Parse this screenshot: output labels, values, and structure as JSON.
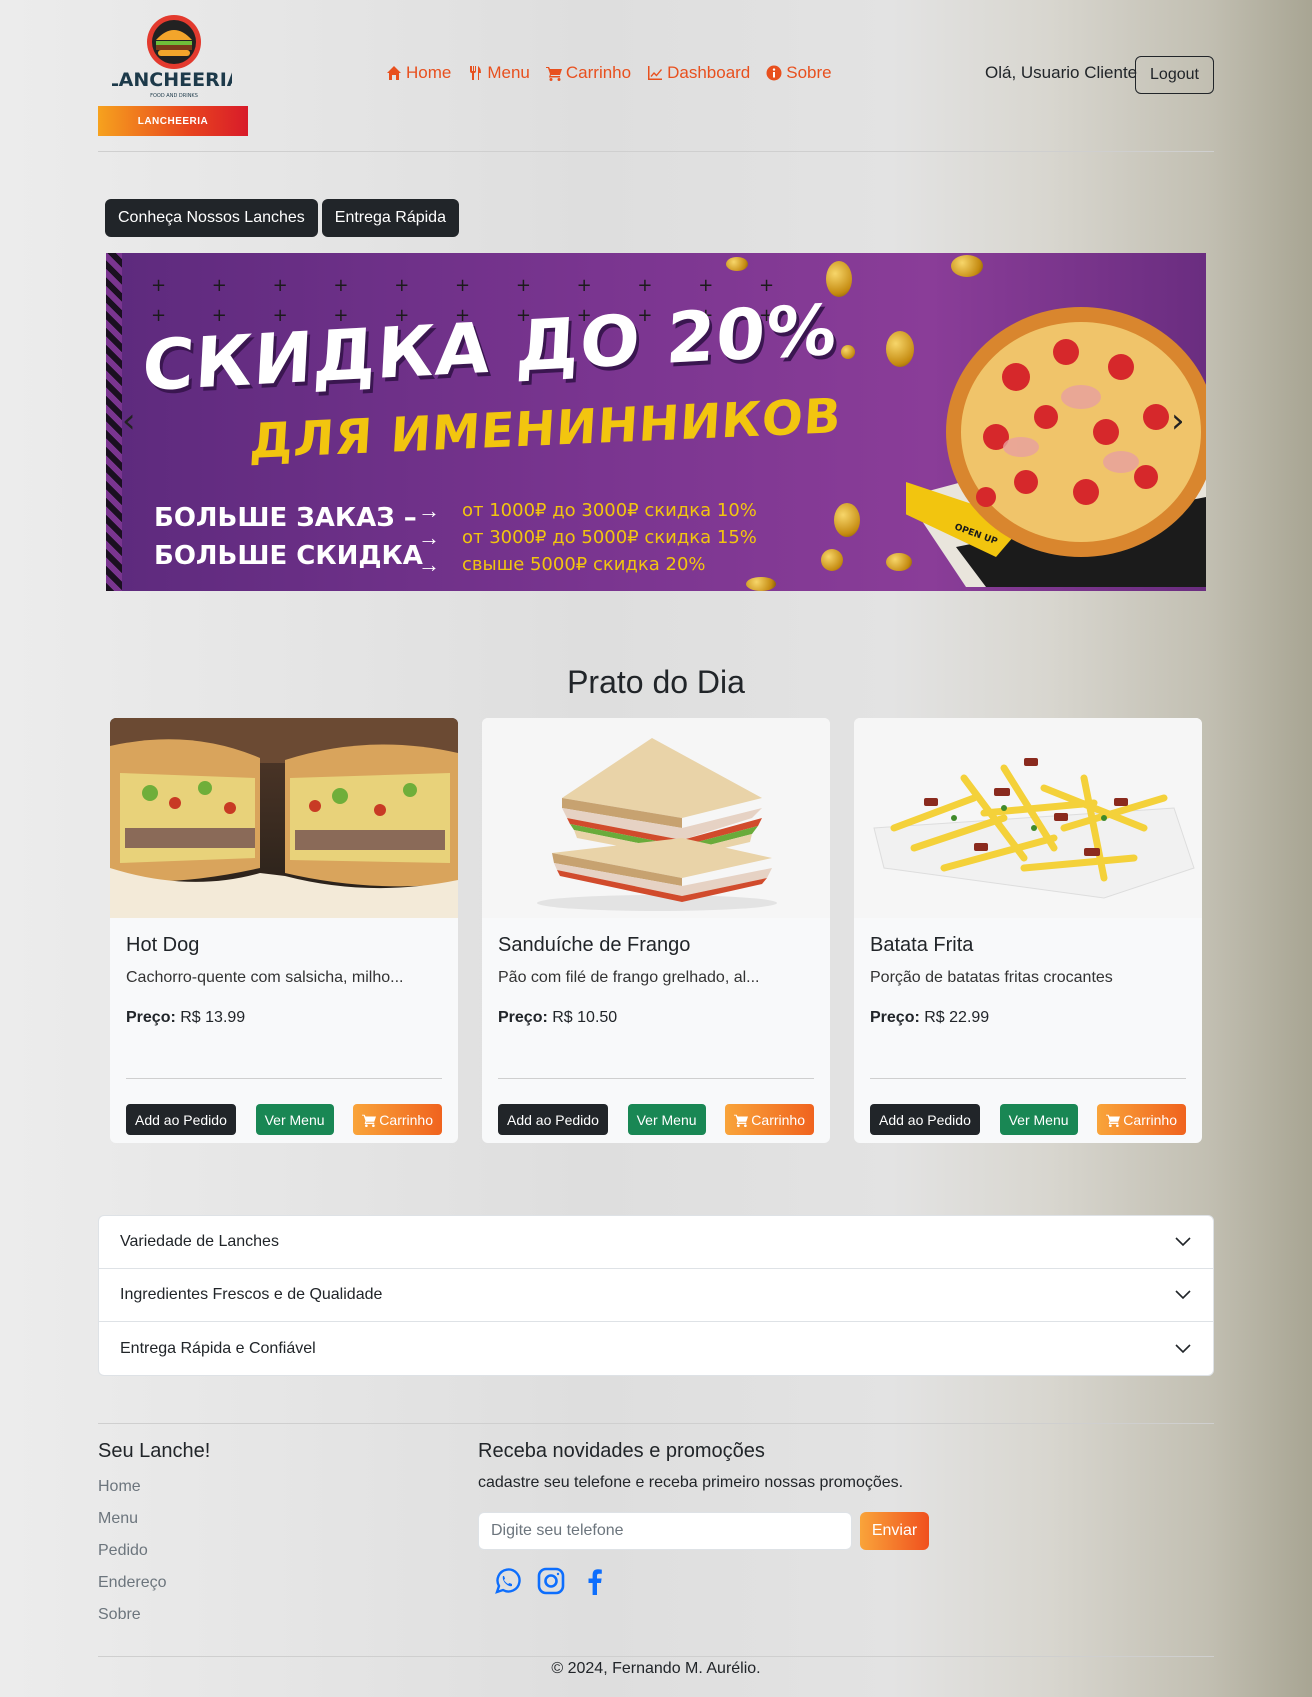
{
  "brand": {
    "name": "LANCHEERIA",
    "tagline": "FOOD AND DRINKS"
  },
  "nav": [
    {
      "label": "Home",
      "icon": "home-icon"
    },
    {
      "label": "Menu",
      "icon": "utensils-icon"
    },
    {
      "label": "Carrinho",
      "icon": "cart-icon"
    },
    {
      "label": "Dashboard",
      "icon": "chart-line-icon"
    },
    {
      "label": "Sobre",
      "icon": "info-circle-icon"
    }
  ],
  "user": {
    "greeting": "Olá, Usuario Cliente",
    "logout_label": "Logout"
  },
  "hero": {
    "btn_primary": "Conheça Nossos Lanches",
    "btn_secondary": "Entrega Rápida"
  },
  "banner": {
    "title": "СКИДКА ДО 20%",
    "subtitle": "ДЛЯ ИМЕНИННИКОВ",
    "left_line1": "БОЛЬШЕ ЗАКАЗ –",
    "left_line2": "БОЛЬШЕ СКИДКА",
    "tier1": "от 1000₽ до 3000₽ скидка 10%",
    "tier2": "от 3000₽ до 5000₽ скидка 15%",
    "tier3": "свыше 5000₽ скидка 20%",
    "box_label": "OPEN UP"
  },
  "section_title": "Prato do Dia",
  "cards": [
    {
      "title": "Hot Dog",
      "desc": "Cachorro-quente com salsicha, milho...",
      "price_label": "Preço:",
      "price": "R$ 13.99",
      "btn_add": "Add ao Pedido",
      "btn_menu": "Ver Menu",
      "btn_cart": "Carrinho"
    },
    {
      "title": "Sanduíche de Frango",
      "desc": "Pão com filé de frango grelhado, al...",
      "price_label": "Preço:",
      "price": "R$ 10.50",
      "btn_add": "Add ao Pedido",
      "btn_menu": "Ver Menu",
      "btn_cart": "Carrinho"
    },
    {
      "title": "Batata Frita",
      "desc": "Porção de batatas fritas crocantes",
      "price_label": "Preço:",
      "price": "R$ 22.99",
      "btn_add": "Add ao Pedido",
      "btn_menu": "Ver Menu",
      "btn_cart": "Carrinho"
    }
  ],
  "accordion": [
    "Variedade de Lanches",
    "Ingredientes Frescos e de Qualidade",
    "Entrega Rápida e Confiável"
  ],
  "footer": {
    "brand": "Seu Lanche!",
    "links": [
      "Home",
      "Menu",
      "Pedido",
      "Endereço",
      "Sobre"
    ],
    "news_title": "Receba novidades e promoções",
    "news_sub": "cadastre seu telefone e receba primeiro nossas promoções.",
    "phone_placeholder": "Digite seu telefone",
    "send_label": "Enviar",
    "socials": [
      "whatsapp-icon",
      "instagram-icon",
      "facebook-icon"
    ],
    "copyright": "© 2024, Fernando M. Aurélio."
  },
  "colors": {
    "accent": "#e8501e",
    "dark": "#212529",
    "green": "#198754",
    "social": "#0d6efd"
  }
}
